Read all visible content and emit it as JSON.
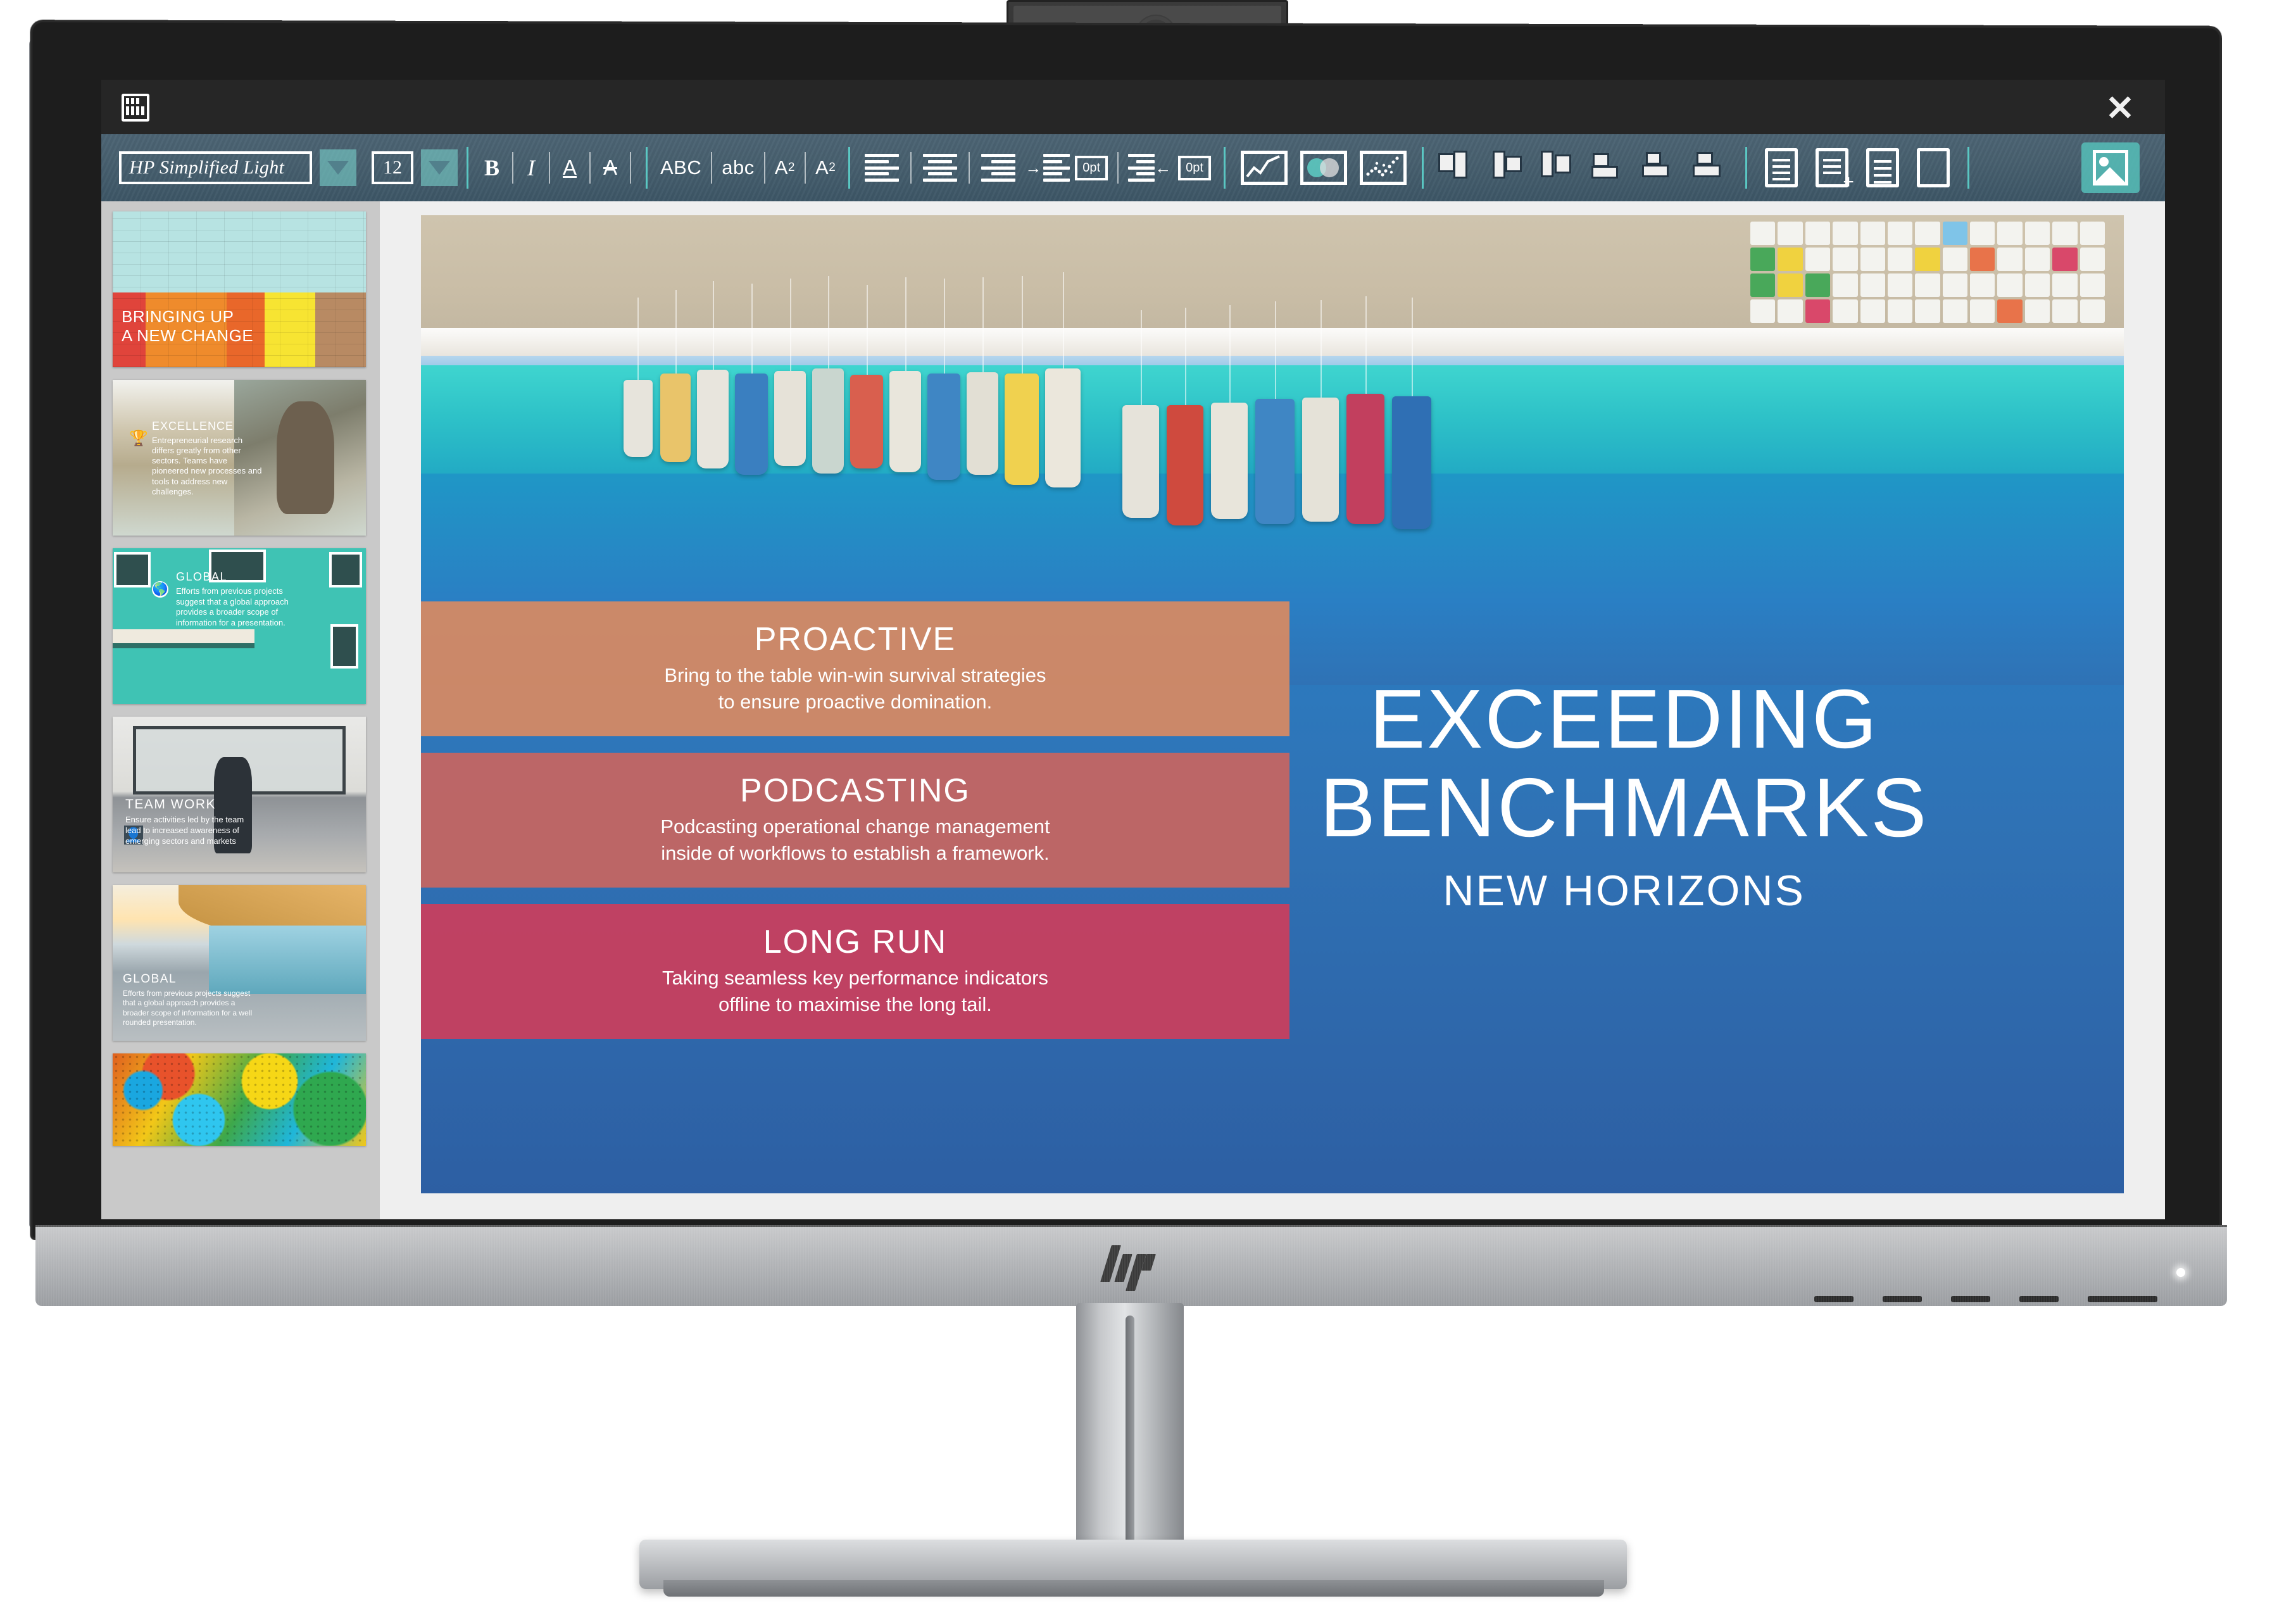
{
  "window": {
    "app_icon": "grid-icon",
    "close_label": "×"
  },
  "toolbar": {
    "font_name": "HP Simplified Light",
    "font_size": "12",
    "font_dropdown_icon": "chevron-down-icon",
    "size_dropdown_icon": "chevron-down-icon",
    "bold": "B",
    "italic": "I",
    "underline": "A",
    "strikethrough": "A",
    "uppercase": "ABC",
    "lowercase": "abc",
    "superscript_base": "A",
    "superscript_sup": "2",
    "subscript_base": "A",
    "subscript_sub": "2",
    "align_left": "align-left-icon",
    "align_center": "align-center-icon",
    "align_right": "align-right-icon",
    "indent_increase_value": "0pt",
    "indent_decrease_value": "0pt",
    "chart_line": "line-chart-icon",
    "chart_venn": "venn-chart-icon",
    "chart_scatter": "scatter-chart-icon",
    "align_objects_left": "object-align-left-icon",
    "align_objects_center": "object-align-center-icon",
    "align_objects_right": "object-align-right-icon",
    "align_objects_top": "object-align-top-icon",
    "align_objects_middle": "object-align-middle-icon",
    "align_objects_bottom": "object-align-bottom-icon",
    "notes": "notepad-icon",
    "add_note": "add-note-icon",
    "document": "document-icon",
    "page": "page-icon",
    "insert_image": "image-icon"
  },
  "sidebar": {
    "slides": [
      {
        "name": "bringing-up-a-new-change",
        "title_line1": "BRINGING UP",
        "title_line2": "A NEW CHANGE"
      },
      {
        "name": "excellence",
        "title": "EXCELLENCE",
        "body": "Entrepreneurial research differs greatly from other sectors. Teams have pioneered new processes and tools to address new challenges.",
        "icon": "trophy-icon"
      },
      {
        "name": "global-teal",
        "title": "GLOBAL",
        "body": "Efforts from previous projects suggest that a global approach provides a broader scope of information for a presentation.",
        "icon": "globe-icon"
      },
      {
        "name": "team-work",
        "title": "TEAM WORK",
        "body": "Ensure activities led by the team lead to increased awareness of emerging sectors and markets",
        "icon": "person-icon"
      },
      {
        "name": "global-building",
        "title": "GLOBAL",
        "body": "Efforts from previous projects suggest that a global approach provides a broader scope of information for a well rounded presentation."
      },
      {
        "name": "colorful-texture",
        "title": ""
      }
    ]
  },
  "slide": {
    "bands": [
      {
        "heading": "PROACTIVE",
        "line1": "Bring to the table win-win survival strategies",
        "line2": "to ensure proactive domination.",
        "color": "#d98a62"
      },
      {
        "heading": "PODCASTING",
        "line1": "Podcasting operational change management",
        "line2": "inside of workflows to establish a framework.",
        "color": "#c9655f"
      },
      {
        "heading": "LONG RUN",
        "line1": "Taking seamless key performance indicators",
        "line2": "offline to maximise the long tail.",
        "color": "#c93f5e"
      }
    ],
    "title_line1": "EXCEEDING",
    "title_line2": "BENCHMARKS",
    "subtitle": "NEW HORIZONS"
  },
  "monitor": {
    "brand_logo": "hp-logo",
    "webcam": "webcam-icon",
    "power_led": "power-led",
    "osd_buttons": [
      "osd-1",
      "osd-2",
      "osd-3",
      "osd-4",
      "power-button"
    ]
  },
  "colors": {
    "toolbar_bg": "#48606f",
    "accent_teal": "#5ed9d2",
    "slide_blue": "#2a7fc4",
    "band_orange": "#d98a62",
    "band_red": "#c9655f",
    "band_crimson": "#c93f5e"
  }
}
